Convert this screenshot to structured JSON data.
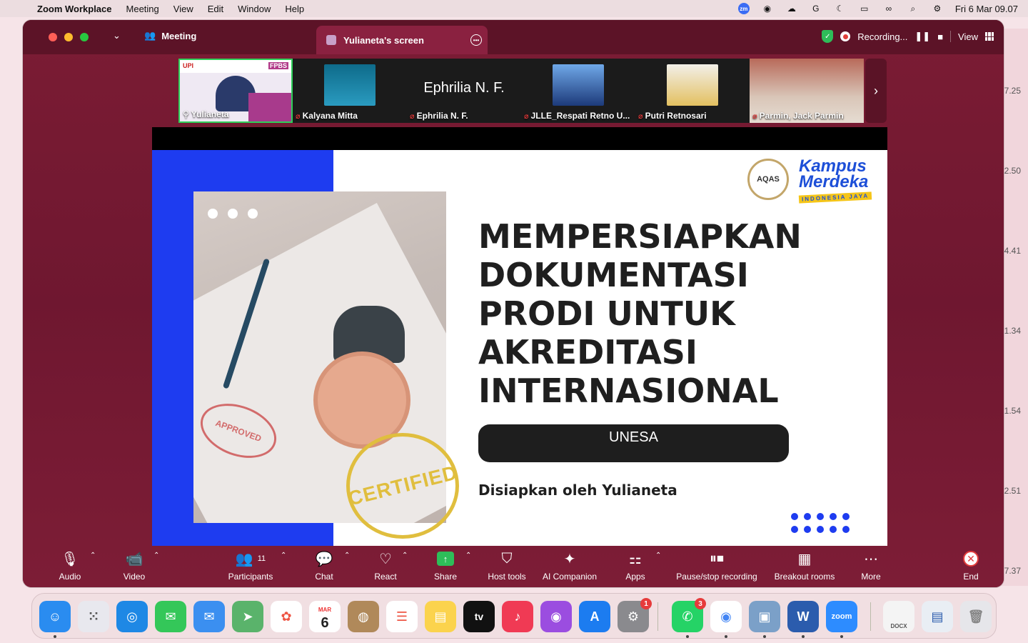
{
  "menubar": {
    "app_name": "Zoom Workplace",
    "items": [
      "Meeting",
      "View",
      "Edit",
      "Window",
      "Help"
    ],
    "datetime": "Fri 6 Mar  09.07"
  },
  "side_numbers": [
    "7.25",
    "2.50",
    "4.41",
    "1.34",
    "1.54",
    "2.51",
    "7.37"
  ],
  "window": {
    "meeting_label": "Meeting",
    "tab_title": "Yulianeta's screen",
    "recording_label": "Recording...",
    "view_label": "View"
  },
  "participants": [
    {
      "name": "Yulianeta",
      "active": true
    },
    {
      "name": "Kalyana Mitta",
      "active": false
    },
    {
      "name": "Ephrilia N. F.",
      "display": "Ephrilia N. F.",
      "active": false
    },
    {
      "name": "JLLE_Respati Retno U...",
      "active": false
    },
    {
      "name": "Putri Retnosari",
      "active": false
    },
    {
      "name": "Parmin, Jack Parmin",
      "active": false
    }
  ],
  "thumb_logo_text": {
    "upi": "UPI",
    "fpbs": "FPBS"
  },
  "slide": {
    "headline": [
      "MEMPERSIAPKAN",
      "DOKUMENTASI",
      "PRODI UNTUK",
      "AKREDITASI",
      "INTERNASIONAL"
    ],
    "pill_text": "UNESA",
    "byline": "Disiapkan oleh Yulianeta",
    "aqas": "AQAS",
    "km_line1": "Kampus",
    "km_line2": "Merdeka",
    "km_line3": "INDONESIA JAYA",
    "certified": "CERTIFIED",
    "approved": "APPROVED"
  },
  "toolbar": {
    "audio": "Audio",
    "video": "Video",
    "participants": "Participants",
    "participants_count": "11",
    "chat": "Chat",
    "react": "React",
    "share": "Share",
    "host_tools": "Host tools",
    "ai_companion": "AI Companion",
    "apps": "Apps",
    "pause_stop": "Pause/stop recording",
    "breakout": "Breakout rooms",
    "more": "More",
    "end": "End"
  },
  "dock": {
    "calendar_month": "MAR",
    "calendar_day": "6",
    "settings_badge": "1",
    "whatsapp_badge": "3",
    "tv_label": "tv",
    "zoom_label": "zoom",
    "word_label": "W",
    "docx_label": "DOCX"
  }
}
